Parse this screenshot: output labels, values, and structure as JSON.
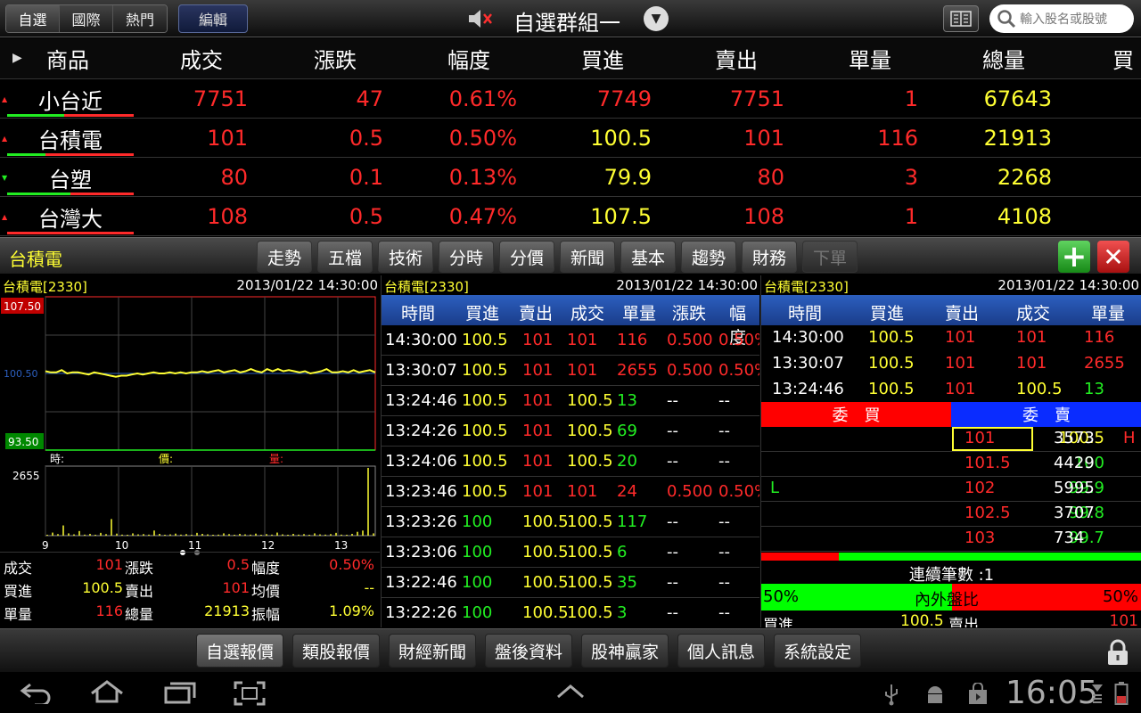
{
  "topbar": {
    "tabs": [
      "自選",
      "國際",
      "熱門"
    ],
    "edit_label": "編輯",
    "group_title": "自選群組一",
    "search_placeholder": "輸入股名或股號"
  },
  "watchlist": {
    "headers": [
      "商品",
      "成交",
      "漲跌",
      "幅度",
      "買進",
      "賣出",
      "單量",
      "總量",
      "買"
    ],
    "rows": [
      {
        "name": "小台近",
        "price": "7751",
        "change": "47",
        "pct": "0.61%",
        "bid": "7749",
        "ask": "7751",
        "vol": "1",
        "total": "67643"
      },
      {
        "name": "台積電",
        "price": "101",
        "change": "0.5",
        "pct": "0.50%",
        "bid": "100.5",
        "ask": "101",
        "vol": "116",
        "total": "21913"
      },
      {
        "name": "台塑",
        "price": "80",
        "change": "0.1",
        "pct": "0.13%",
        "bid": "79.9",
        "ask": "80",
        "vol": "3",
        "total": "2268"
      },
      {
        "name": "台灣大",
        "price": "108",
        "change": "0.5",
        "pct": "0.47%",
        "bid": "107.5",
        "ask": "108",
        "vol": "1",
        "total": "4108"
      }
    ]
  },
  "detail": {
    "stock_name": "台積電",
    "tabs": [
      "走勢",
      "五檔",
      "技術",
      "分時",
      "分價",
      "新聞",
      "基本",
      "趨勢",
      "財務",
      "下單"
    ],
    "panel_title": "台積電[2330]",
    "panel_date": "2013/01/22 14:30:00"
  },
  "chart_data": {
    "type": "line",
    "title": "",
    "price_axis": {
      "max_label": "107.50",
      "mid_label": "100.50",
      "min_label": "93.50",
      "ylim": [
        93.5,
        107.5
      ]
    },
    "volume_axis": {
      "max_label": "2655",
      "ylim": [
        0,
        2655
      ]
    },
    "x_ticks": [
      "9",
      "10",
      "11",
      "12",
      "13"
    ],
    "legend": {
      "time": "時:",
      "price": "價:",
      "volume": "量:"
    },
    "series": [
      {
        "name": "",
        "values": [
          100.7,
          100.6,
          100.6,
          100.8,
          100.5,
          100.6,
          100.6,
          100.5,
          100.4,
          100.6,
          100.5,
          100.4,
          100.3,
          100.2,
          100.3,
          100.3,
          100.4,
          100.5,
          100.4,
          100.5,
          100.6,
          100.5,
          100.5,
          100.6,
          100.5,
          100.6,
          100.5,
          100.6,
          100.6,
          100.7,
          100.6,
          100.7,
          100.8,
          100.6,
          100.7,
          100.8,
          100.6,
          100.7,
          100.9,
          100.7,
          100.6,
          100.9,
          100.7,
          100.9,
          100.7,
          100.8,
          100.7,
          100.6,
          100.7,
          100.5,
          100.6,
          100.7,
          100.9,
          100.6,
          100.6,
          100.7,
          100.6,
          100.8,
          100.6,
          100.7,
          100.8,
          100.6
        ]
      },
      {
        "name": "",
        "values": [
          30,
          120,
          60,
          400,
          90,
          50,
          180,
          40,
          70,
          30,
          110,
          60,
          650,
          80,
          40,
          30,
          90,
          50,
          60,
          40,
          200,
          70,
          30,
          50,
          80,
          40,
          60,
          30,
          110,
          70,
          50,
          30,
          40,
          90,
          60,
          30,
          70,
          50,
          40,
          80,
          30,
          60,
          40,
          120,
          50,
          30,
          70,
          40,
          60,
          30,
          90,
          50,
          40,
          60,
          110,
          40,
          30,
          70,
          150,
          200,
          2655,
          90
        ]
      }
    ]
  },
  "quote": {
    "l1": "成交",
    "v1": "101",
    "l2": "漲跌",
    "v2": "0.5",
    "l3": "幅度",
    "v3": "0.50%",
    "l4": "買進",
    "v4": "100.5",
    "l5": "賣出",
    "v5": "101",
    "l6": "均價",
    "v6": "--",
    "l7": "單量",
    "v7": "116",
    "l8": "總量",
    "v8": "21913",
    "l9": "振幅",
    "v9": "1.09%"
  },
  "ticks": {
    "headers": [
      "時間",
      "買進",
      "賣出",
      "成交",
      "單量",
      "漲跌",
      "幅度"
    ],
    "rows": [
      [
        "14:30:00",
        "100.5",
        "101",
        "101",
        "116",
        "0.500",
        "0.50%"
      ],
      [
        "13:30:07",
        "100.5",
        "101",
        "101",
        "2655",
        "0.500",
        "0.50%"
      ],
      [
        "13:24:46",
        "100.5",
        "101",
        "100.5",
        "13",
        "--",
        "--"
      ],
      [
        "13:24:26",
        "100.5",
        "101",
        "100.5",
        "69",
        "--",
        "--"
      ],
      [
        "13:24:06",
        "100.5",
        "101",
        "100.5",
        "20",
        "--",
        "--"
      ],
      [
        "13:23:46",
        "100.5",
        "101",
        "101",
        "24",
        "0.500",
        "0.50%"
      ],
      [
        "13:23:26",
        "100",
        "100.5",
        "100.5",
        "117",
        "--",
        "--"
      ],
      [
        "13:23:06",
        "100",
        "100.5",
        "100.5",
        "6",
        "--",
        "--"
      ],
      [
        "13:22:46",
        "100",
        "100.5",
        "100.5",
        "35",
        "--",
        "--"
      ],
      [
        "13:22:26",
        "100",
        "100.5",
        "100.5",
        "3",
        "--",
        "--"
      ]
    ]
  },
  "book": {
    "headers": [
      "時間",
      "買進",
      "賣出",
      "成交",
      "單量"
    ],
    "recent": [
      [
        "14:30:00",
        "100.5",
        "101",
        "101",
        "116"
      ],
      [
        "13:30:07",
        "100.5",
        "101",
        "101",
        "2655"
      ],
      [
        "13:24:46",
        "100.5",
        "101",
        "100.5",
        "13"
      ]
    ],
    "bid_label": "委　買",
    "ask_label": "委　賣",
    "levels": [
      {
        "mark_l": "",
        "bid_vol": "271",
        "bid": "100.5",
        "ask": "101",
        "ask_vol": "3573",
        "mark_r": "H"
      },
      {
        "mark_l": "",
        "bid_vol": "4011",
        "bid": "100",
        "ask": "101.5",
        "ask_vol": "4429",
        "mark_r": ""
      },
      {
        "mark_l": "L",
        "bid_vol": "190",
        "bid": "99.9",
        "ask": "102",
        "ask_vol": "5995",
        "mark_r": ""
      },
      {
        "mark_l": "",
        "bid_vol": "178",
        "bid": "99.8",
        "ask": "102.5",
        "ask_vol": "3707",
        "mark_r": ""
      },
      {
        "mark_l": "",
        "bid_vol": "87",
        "bid": "99.7",
        "ask": "103",
        "ask_vol": "734",
        "mark_r": ""
      }
    ],
    "streak_label": "連續筆數 :1",
    "ratio_left": "50%",
    "ratio_label": "內外盤比",
    "ratio_right": "50%",
    "bottom_bid_label": "買進",
    "bottom_bid": "100.5",
    "bottom_ask_label": "賣出",
    "bottom_ask": "101"
  },
  "bottom_tabs": [
    "自選報價",
    "類股報價",
    "財經新聞",
    "盤後資料",
    "股神贏家",
    "個人訊息",
    "系統設定"
  ],
  "system": {
    "clock": "16:05"
  },
  "colors": {
    "up": "#ff2a2a",
    "equal": "#ffff33",
    "down": "#22ee22",
    "header_blue": "#2c5fbf"
  }
}
